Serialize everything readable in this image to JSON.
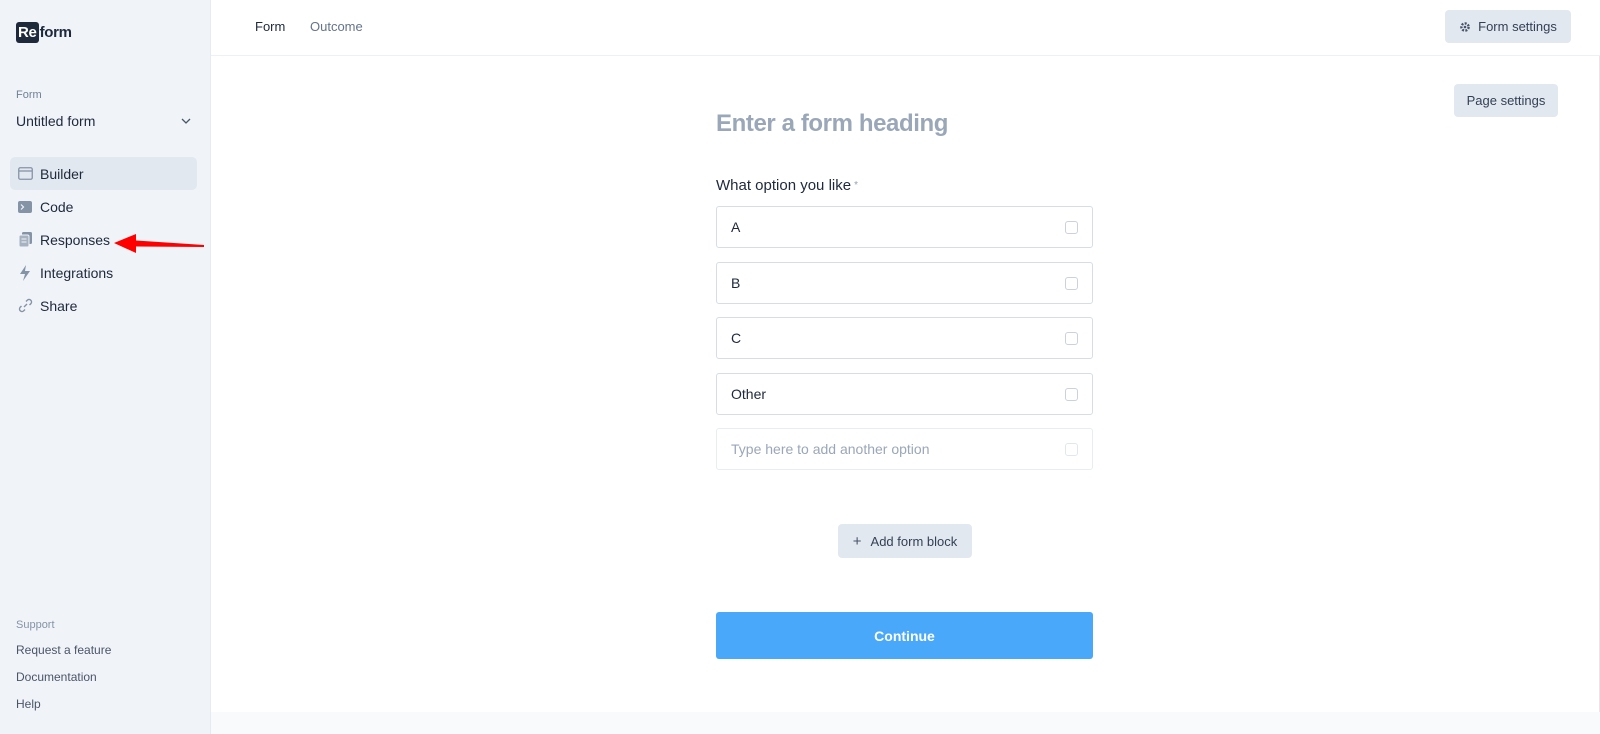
{
  "sidebar": {
    "logo_prefix": "Re",
    "logo_suffix": "form",
    "form_label": "Form",
    "form_name": "Untitled form",
    "nav": [
      {
        "label": "Builder",
        "icon": "browser-window-icon",
        "active": true
      },
      {
        "label": "Code",
        "icon": "terminal-icon"
      },
      {
        "label": "Responses",
        "icon": "clipboard-icon"
      },
      {
        "label": "Integrations",
        "icon": "lightning-icon"
      },
      {
        "label": "Share",
        "icon": "link-icon"
      }
    ],
    "support_label": "Support",
    "support_links": [
      "Request a feature",
      "Documentation",
      "Help"
    ]
  },
  "topbar": {
    "tabs": [
      {
        "label": "Form",
        "active": true
      },
      {
        "label": "Outcome",
        "active": false
      }
    ],
    "form_settings": "Form settings"
  },
  "canvas": {
    "page_settings": "Page settings",
    "heading_placeholder": "Enter a form heading",
    "question": "What option you like",
    "required_marker": "*",
    "options": [
      "A",
      "B",
      "C",
      "Other"
    ],
    "add_option_placeholder": "Type here to add another option",
    "add_block": "Add form block",
    "continue": "Continue"
  },
  "colors": {
    "sidebar_bg": "#f0f4f8",
    "accent": "#4aa8fa",
    "arrow": "#ff0000"
  }
}
